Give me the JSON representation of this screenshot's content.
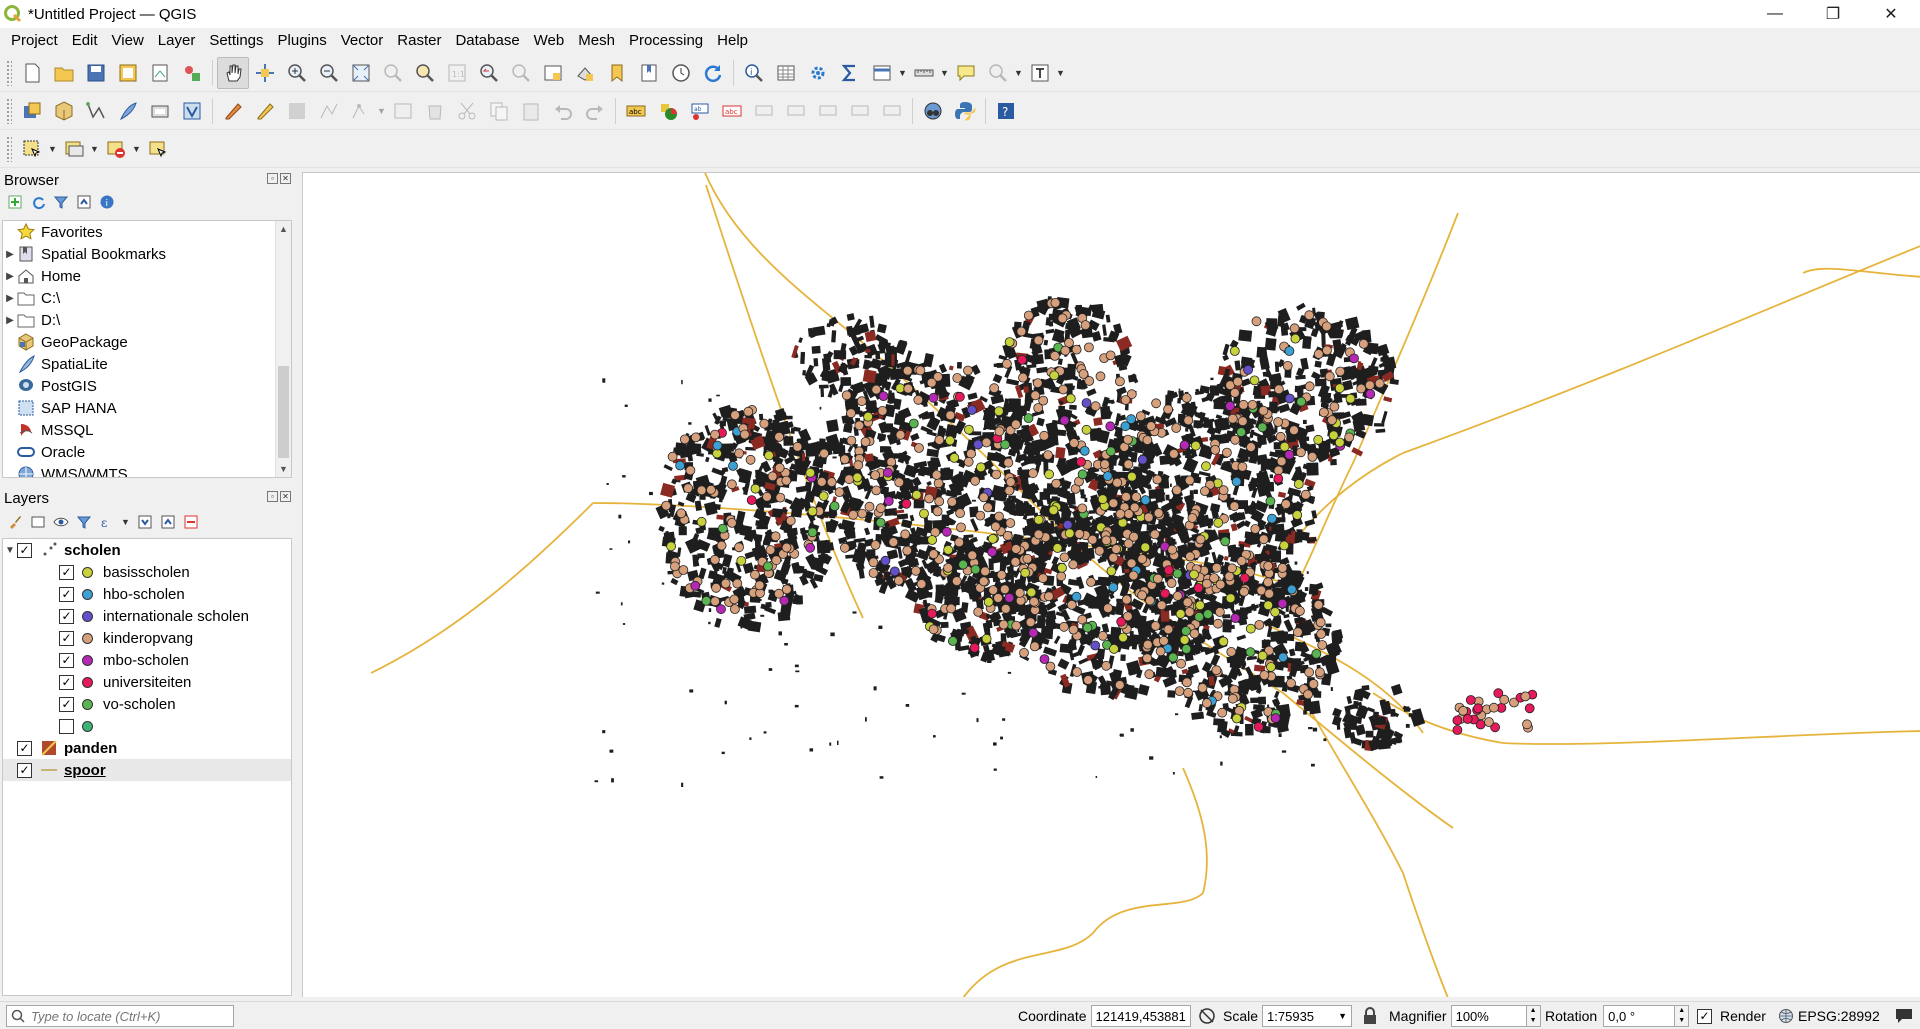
{
  "window": {
    "title": "*Untitled Project — QGIS",
    "minimize": "—",
    "maximize": "❐",
    "close": "✕"
  },
  "menu": [
    "Project",
    "Edit",
    "View",
    "Layer",
    "Settings",
    "Plugins",
    "Vector",
    "Raster",
    "Database",
    "Web",
    "Mesh",
    "Processing",
    "Help"
  ],
  "browser": {
    "title": "Browser",
    "items": [
      {
        "label": "Favorites",
        "icon": "star-icon",
        "expandable": false
      },
      {
        "label": "Spatial Bookmarks",
        "icon": "bookmark-icon",
        "expandable": true
      },
      {
        "label": "Home",
        "icon": "home-icon",
        "expandable": true
      },
      {
        "label": "C:\\",
        "icon": "folder-icon",
        "expandable": true
      },
      {
        "label": "D:\\",
        "icon": "folder-icon",
        "expandable": true
      },
      {
        "label": "GeoPackage",
        "icon": "geopackage-icon",
        "expandable": false
      },
      {
        "label": "SpatiaLite",
        "icon": "spatialite-icon",
        "expandable": false
      },
      {
        "label": "PostGIS",
        "icon": "postgis-icon",
        "expandable": false
      },
      {
        "label": "SAP HANA",
        "icon": "sap-hana-icon",
        "expandable": false
      },
      {
        "label": "MSSQL",
        "icon": "mssql-icon",
        "expandable": false
      },
      {
        "label": "Oracle",
        "icon": "oracle-icon",
        "expandable": false
      },
      {
        "label": "WMS/WMTS",
        "icon": "wms-icon",
        "expandable": false
      }
    ]
  },
  "layers": {
    "title": "Layers",
    "groups": [
      {
        "name": "scholen",
        "checked": true,
        "classes": [
          {
            "label": "basisscholen",
            "color": "#c8d23c",
            "checked": true
          },
          {
            "label": "hbo-scholen",
            "color": "#3ca0d2",
            "checked": true
          },
          {
            "label": "internationale scholen",
            "color": "#6450c8",
            "checked": true
          },
          {
            "label": "kinderopvang",
            "color": "#d7a07d",
            "checked": true
          },
          {
            "label": "mbo-scholen",
            "color": "#b428b4",
            "checked": true
          },
          {
            "label": "universiteiten",
            "color": "#e6195a",
            "checked": true
          },
          {
            "label": "vo-scholen",
            "color": "#5ab450",
            "checked": true
          },
          {
            "label": "",
            "color": "#3cb478",
            "checked": false
          }
        ]
      }
    ],
    "other": [
      {
        "name": "panden",
        "checked": true
      },
      {
        "name": "spoor",
        "checked": true
      }
    ]
  },
  "status": {
    "locator_placeholder": "Type to locate (Ctrl+K)",
    "coordinate_label": "Coordinate",
    "coordinate_value": "121419,453881",
    "scale_label": "Scale",
    "scale_value": "1:75935",
    "magnifier_label": "Magnifier",
    "magnifier_value": "100%",
    "rotation_label": "Rotation",
    "rotation_value": "0,0 °",
    "render_label": "Render",
    "render_checked": true,
    "crs": "EPSG:28992"
  },
  "map": {
    "building_color": "#1e1e1e",
    "rail_color": "#e6b43c",
    "background": "#ffffff"
  }
}
